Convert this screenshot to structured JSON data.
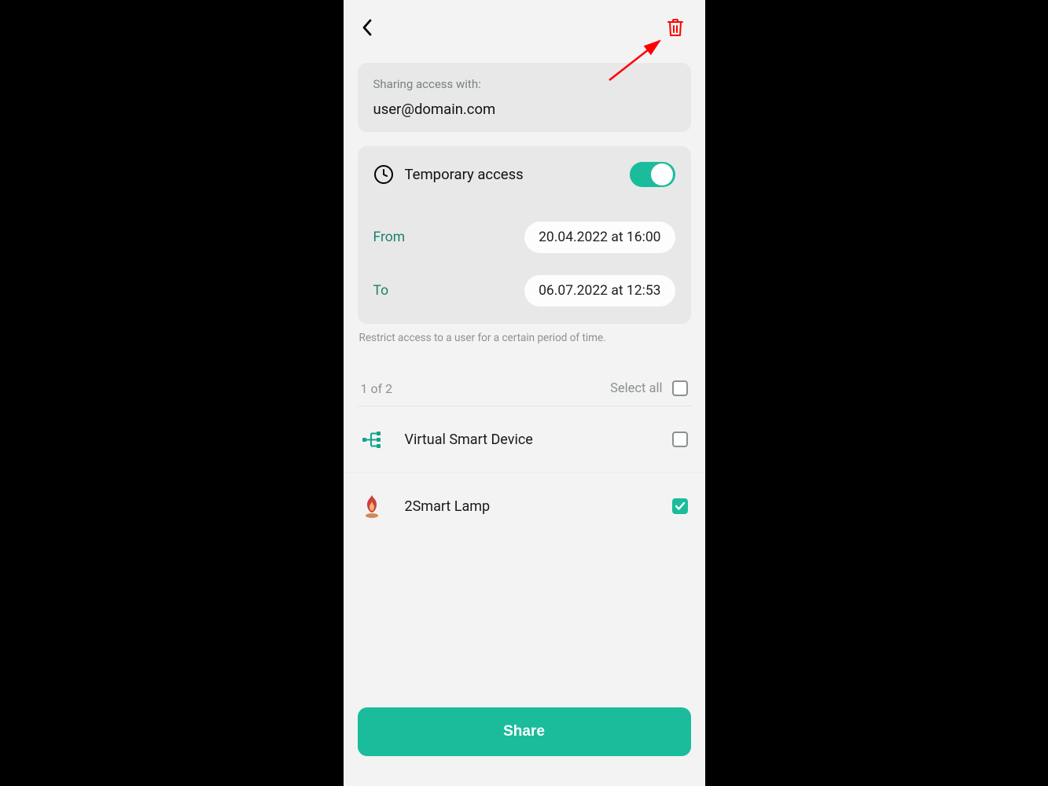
{
  "header": {
    "delete_icon": "trash-icon",
    "back_icon": "back-chevron-icon"
  },
  "share_with": {
    "label": "Sharing access with:",
    "value": "user@domain.com"
  },
  "temporary": {
    "title": "Temporary access",
    "enabled": true,
    "from_label": "From",
    "from_value": "20.04.2022 at 16:00",
    "to_label": "To",
    "to_value": "06.07.2022 at 12:53",
    "hint": "Restrict access to a user for a certain period of time."
  },
  "device_list": {
    "counter": "1 of 2",
    "select_all_label": "Select all",
    "select_all_checked": false,
    "items": [
      {
        "name": "Virtual Smart Device",
        "icon": "network-icon",
        "checked": false
      },
      {
        "name": "2Smart Lamp",
        "icon": "flame-icon",
        "checked": true
      }
    ]
  },
  "actions": {
    "share_label": "Share"
  },
  "colors": {
    "accent": "#1abc9c",
    "danger": "#ff0000"
  }
}
